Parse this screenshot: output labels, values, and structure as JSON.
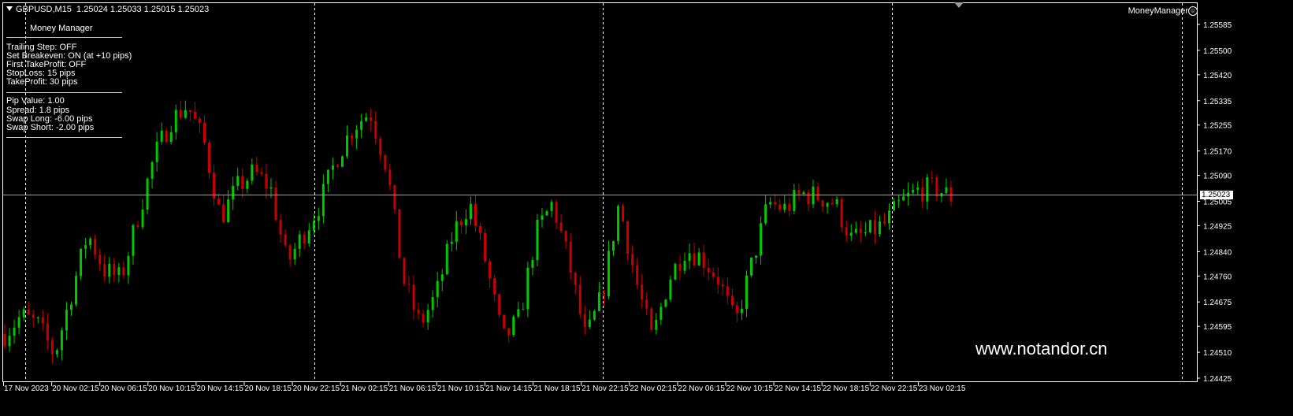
{
  "header": {
    "symbol": "GBPUSD,M15",
    "ohlc": "1.25024 1.25033 1.25015 1.25023"
  },
  "money_manager": {
    "title": "Money Manager",
    "items": [
      "Trailing Step: OFF",
      "Set Breakeven: ON (at +10 pips)",
      "First TakeProfit: OFF",
      "StopLoss: 15 pips",
      "TakeProfit: 30 pips"
    ],
    "items2": [
      "Pip Value: 1.00",
      "Spread: 1.8 pips",
      "Swap Long: -6.00 pips",
      "Swap Short: -2.00 pips"
    ]
  },
  "expert": {
    "name": "MoneyManager",
    "icon": "smiley-icon"
  },
  "watermark": "www.notandor.cn",
  "current_price": "1.25023",
  "colors": {
    "bull": "#00c800",
    "bear": "#c80000",
    "background": "#000000",
    "text": "#ffffff",
    "grid": "#ffffff"
  },
  "chart_data": {
    "type": "candlestick",
    "symbol": "GBPUSD",
    "timeframe": "M15",
    "price_ticks": [
      "1.25585",
      "1.25500",
      "1.25420",
      "1.25335",
      "1.25255",
      "1.25170",
      "1.25090",
      "1.25005",
      "1.24925",
      "1.24840",
      "1.24760",
      "1.24675",
      "1.24595",
      "1.24510",
      "1.24425"
    ],
    "time_ticks": [
      "17 Nov 2023",
      "20 Nov 02:15",
      "20 Nov 06:15",
      "20 Nov 10:15",
      "20 Nov 14:15",
      "20 Nov 18:15",
      "20 Nov 22:15",
      "21 Nov 02:15",
      "21 Nov 06:15",
      "21 Nov 10:15",
      "21 Nov 14:15",
      "21 Nov 18:15",
      "21 Nov 22:15",
      "22 Nov 02:15",
      "22 Nov 06:15",
      "22 Nov 10:15",
      "22 Nov 14:15",
      "22 Nov 18:15",
      "22 Nov 22:15",
      "23 Nov 02:15"
    ],
    "y_range": [
      1.24425,
      1.25615
    ],
    "current_price": 1.25023,
    "series_closes": [
      1.2457,
      1.2463,
      1.246,
      1.245,
      1.247,
      1.249,
      1.2478,
      1.2475,
      1.2495,
      1.2515,
      1.2527,
      1.2532,
      1.252,
      1.2495,
      1.2505,
      1.251,
      1.2505,
      1.248,
      1.249,
      1.25,
      1.2515,
      1.2525,
      1.253,
      1.2512,
      1.2475,
      1.246,
      1.247,
      1.249,
      1.25,
      1.248,
      1.2455,
      1.2462,
      1.249,
      1.25,
      1.248,
      1.2455,
      1.247,
      1.25,
      1.2475,
      1.2455,
      1.2475,
      1.2485,
      1.2482,
      1.2475,
      1.246,
      1.248,
      1.25,
      1.2498,
      1.2503,
      1.2502,
      1.25,
      1.2488,
      1.249,
      1.2493,
      1.25,
      1.2504,
      1.2505,
      1.2502
    ]
  }
}
